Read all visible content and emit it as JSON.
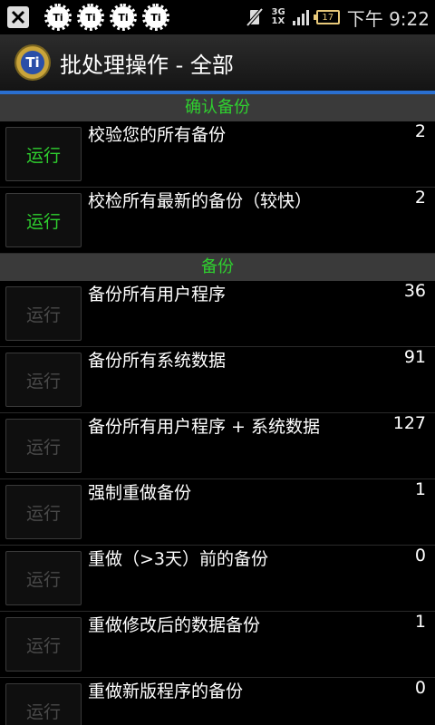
{
  "status_bar": {
    "notification_icons": [
      {
        "icon": "x-app-icon",
        "text": ""
      },
      {
        "icon": "titanium-icon",
        "text": "Ti"
      },
      {
        "icon": "titanium-icon",
        "text": "Ti"
      },
      {
        "icon": "titanium-icon",
        "text": "Ti"
      },
      {
        "icon": "titanium-icon",
        "text": "Ti"
      }
    ],
    "network_top": "3G",
    "network_bottom": "1X",
    "battery": "17",
    "time": "下午 9:22"
  },
  "app": {
    "logo_text": "Ti",
    "title": "批处理操作 - 全部"
  },
  "sections": [
    {
      "header": "确认备份",
      "rows": [
        {
          "button": "运行",
          "label": "校验您的所有备份",
          "count": "2",
          "enabled": true
        },
        {
          "button": "运行",
          "label": "校检所有最新的备份（较快）",
          "count": "2",
          "enabled": true
        }
      ]
    },
    {
      "header": "备份",
      "rows": [
        {
          "button": "运行",
          "label": "备份所有用户程序",
          "count": "36",
          "enabled": false
        },
        {
          "button": "运行",
          "label": "备份所有系统数据",
          "count": "91",
          "enabled": false
        },
        {
          "button": "运行",
          "label": "备份所有用户程序 + 系统数据",
          "count": "127",
          "enabled": false
        },
        {
          "button": "运行",
          "label": "强制重做备份",
          "count": "1",
          "enabled": false
        },
        {
          "button": "运行",
          "label": "重做（>3天）前的备份",
          "count": "0",
          "enabled": false
        },
        {
          "button": "运行",
          "label": "重做修改后的数据备份",
          "count": "1",
          "enabled": false
        },
        {
          "button": "运行",
          "label": "重做新版程序的备份",
          "count": "0",
          "enabled": false
        }
      ]
    }
  ],
  "colors": {
    "accent_green": "#2fd02f",
    "title_underline": "#2a6fd0",
    "section_bg": "#3a3a3a"
  }
}
